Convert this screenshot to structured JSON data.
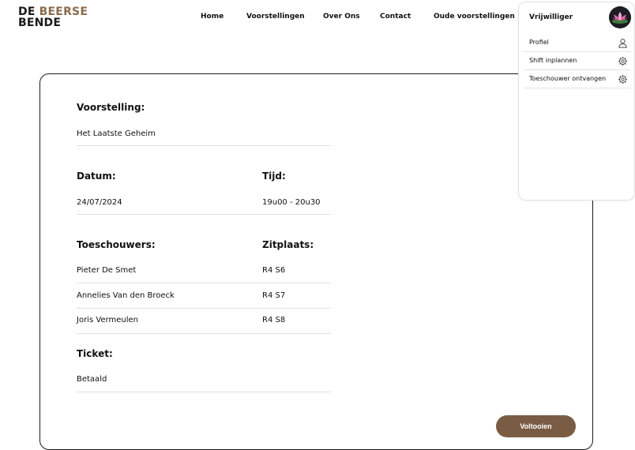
{
  "logo": {
    "line1_part1": "DE",
    "line1_part2": "BEERSE",
    "line2": "BENDE"
  },
  "nav": {
    "home": "Home",
    "voorstellingen": "Voorstellingen",
    "over_ons": "Over Ons",
    "contact": "Contact",
    "oude": "Oude voorstellingen"
  },
  "menu": {
    "title": "Vrijwilliger",
    "items": [
      {
        "label": "Profiel",
        "icon": "user-icon"
      },
      {
        "label": "Shift inplannen",
        "icon": "gear-icon"
      },
      {
        "label": "Toeschouwer ontvangen",
        "icon": "gear-icon"
      }
    ]
  },
  "form": {
    "voorstelling_label": "Voorstelling:",
    "voorstelling_value": "Het Laatste Geheim",
    "datum_label": "Datum:",
    "datum_value": "24/07/2024",
    "tijd_label": "Tijd:",
    "tijd_value": "19u00 - 20u30",
    "toeschouwers_label": "Toeschouwers:",
    "zitplaats_label": "Zitplaats:",
    "rows": [
      {
        "name": "Pieter De Smet",
        "seat": "R4 S6"
      },
      {
        "name": "Annelies Van den Broeck",
        "seat": "R4 S7"
      },
      {
        "name": "Joris Vermeulen",
        "seat": "R4 S8"
      }
    ],
    "ticket_label": "Ticket:",
    "ticket_value": "Betaald"
  },
  "actions": {
    "submit": "Voltooien"
  },
  "colors": {
    "accent": "#7a5c45",
    "logo_accent": "#8a6a4f",
    "border": "#1a1a1a"
  }
}
